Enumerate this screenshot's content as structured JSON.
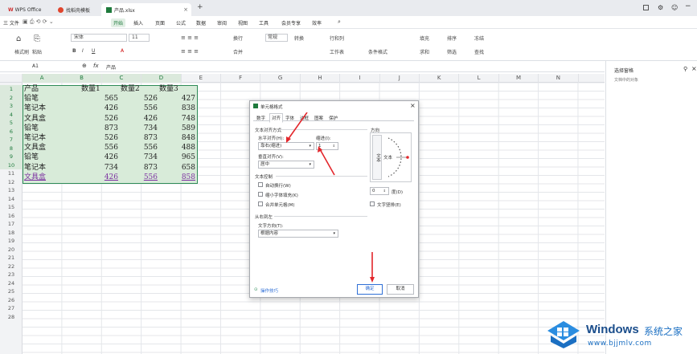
{
  "tabs": {
    "wps": "WPS Office",
    "template": "找稻壳模板",
    "file": "产品.xlsx",
    "add": "+"
  },
  "menu": [
    "三 文件",
    "开始",
    "插入",
    "页面",
    "公式",
    "数据",
    "审阅",
    "视图",
    "工具",
    "会员专享",
    "效率"
  ],
  "ribbon": {
    "paste": "格式刷",
    "paste2": "粘贴",
    "font": "宋体",
    "size": "11",
    "bold": "B",
    "italic": "I",
    "underline": "U",
    "wrap": "换行",
    "merge": "合并",
    "normal": "常规",
    "convert": "转换",
    "rowcol": "行和列",
    "worksheet": "工作表",
    "condformat": "条件格式",
    "fill": "填充",
    "sort": "排序",
    "freeze": "冻结",
    "sum": "求和",
    "filter": "筛选",
    "find": "查找"
  },
  "formula": {
    "cellref": "A1",
    "fx": "fx",
    "value": "产品"
  },
  "columns": [
    "A",
    "B",
    "C",
    "D",
    "E",
    "F",
    "G",
    "H",
    "I",
    "J",
    "K",
    "L",
    "M",
    "N"
  ],
  "rows": [
    "1",
    "2",
    "3",
    "4",
    "5",
    "6",
    "7",
    "8",
    "9",
    "10",
    "11",
    "12",
    "13",
    "14",
    "15",
    "16",
    "17",
    "18",
    "19",
    "20",
    "21",
    "22",
    "23",
    "24",
    "25",
    "26",
    "27",
    "28"
  ],
  "table": {
    "headers": [
      "产品",
      "数量1",
      "数量2",
      "数量3"
    ],
    "rows": [
      [
        "铅笔",
        "565",
        "526",
        "427"
      ],
      [
        "笔记本",
        "426",
        "556",
        "838"
      ],
      [
        "文具盒",
        "526",
        "426",
        "748"
      ],
      [
        "铅笔",
        "873",
        "734",
        "589"
      ],
      [
        "笔记本",
        "526",
        "873",
        "848"
      ],
      [
        "文具盒",
        "556",
        "556",
        "488"
      ],
      [
        "铅笔",
        "426",
        "734",
        "965"
      ],
      [
        "笔记本",
        "734",
        "873",
        "658"
      ],
      [
        "文具盒",
        "426",
        "556",
        "858"
      ]
    ]
  },
  "sidepane": {
    "title": "选择窗格",
    "subtitle": "文档中的对象"
  },
  "dialog": {
    "title": "单元格格式",
    "tabs": [
      "数字",
      "对齐",
      "字体",
      "边框",
      "图案",
      "保护"
    ],
    "active_tab": "对齐",
    "section_align": "文本对齐方式",
    "h_align_label": "水平对齐(H):",
    "h_align_value": "靠右(缩进)",
    "indent_label": "缩进(I):",
    "indent_value": "1",
    "v_align_label": "垂直对齐(V):",
    "v_align_value": "居中",
    "section_control": "文本控制",
    "wrap": "自动换行(W)",
    "shrink": "缩小字体填充(K)",
    "merge": "合并单元格(M)",
    "section_rtl": "从右到左",
    "direction_label": "文字方向(T):",
    "direction_value": "根据内容",
    "orientation": "方向",
    "vertical_text": "文本",
    "horizontal_text": "文本",
    "degree_value": "0",
    "degree_unit": "度(D)",
    "stack_text": "文字竖排(E)",
    "tips": "操作技巧",
    "ok": "确定",
    "cancel": "取消",
    "close": "×"
  },
  "watermark": {
    "title": "Windows",
    "accent": "系统之家",
    "url": "www.bjjmlv.com"
  },
  "colors": {
    "selection": "#d8ebd9",
    "selection_border": "#2e8b57",
    "accent": "#1e7a3c",
    "arrow": "#e3262b",
    "ok_button": "#2f6fd6"
  }
}
